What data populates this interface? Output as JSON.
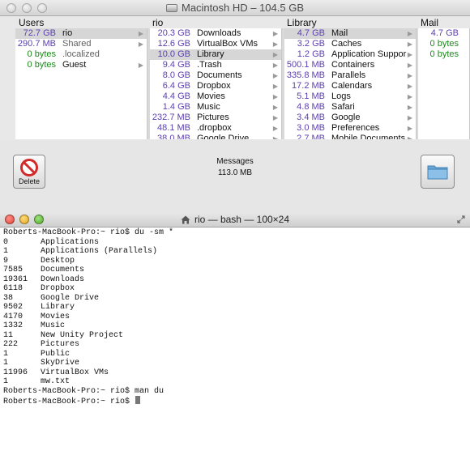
{
  "finder": {
    "title": "Macintosh HD – 104.5 GB",
    "columns": [
      {
        "header": "Users",
        "items": [
          {
            "size": "72.7 GB",
            "name": "rio",
            "selected": true,
            "arrow": true,
            "size_color": "purple"
          },
          {
            "size": "290.7 MB",
            "name": "Shared",
            "selected": false,
            "arrow": true,
            "size_color": "purple",
            "dim": true
          },
          {
            "size": "0 bytes",
            "name": ".localized",
            "selected": false,
            "arrow": false,
            "size_color": "green",
            "dim": true
          },
          {
            "size": "0 bytes",
            "name": "Guest",
            "selected": false,
            "arrow": true,
            "size_color": "green"
          }
        ]
      },
      {
        "header": "rio",
        "items": [
          {
            "size": "20.3 GB",
            "name": "Downloads",
            "selected": false,
            "arrow": true,
            "size_color": "purple"
          },
          {
            "size": "12.6 GB",
            "name": "VirtualBox VMs",
            "selected": false,
            "arrow": true,
            "size_color": "purple"
          },
          {
            "size": "10.0 GB",
            "name": "Library",
            "selected": true,
            "arrow": true,
            "size_color": "purple"
          },
          {
            "size": "9.4 GB",
            "name": ".Trash",
            "selected": false,
            "arrow": true,
            "size_color": "purple"
          },
          {
            "size": "8.0 GB",
            "name": "Documents",
            "selected": false,
            "arrow": true,
            "size_color": "purple"
          },
          {
            "size": "6.4 GB",
            "name": "Dropbox",
            "selected": false,
            "arrow": true,
            "size_color": "purple"
          },
          {
            "size": "4.4 GB",
            "name": "Movies",
            "selected": false,
            "arrow": true,
            "size_color": "purple"
          },
          {
            "size": "1.4 GB",
            "name": "Music",
            "selected": false,
            "arrow": true,
            "size_color": "purple"
          },
          {
            "size": "232.7 MB",
            "name": "Pictures",
            "selected": false,
            "arrow": true,
            "size_color": "purple"
          },
          {
            "size": "48.1 MB",
            "name": ".dropbox",
            "selected": false,
            "arrow": true,
            "size_color": "purple"
          },
          {
            "size": "38.0 MB",
            "name": "Google Drive",
            "selected": false,
            "arrow": true,
            "size_color": "purple"
          }
        ]
      },
      {
        "header": "Library",
        "items": [
          {
            "size": "4.7 GB",
            "name": "Mail",
            "selected": true,
            "arrow": true,
            "size_color": "purple"
          },
          {
            "size": "3.2 GB",
            "name": "Caches",
            "selected": false,
            "arrow": true,
            "size_color": "purple"
          },
          {
            "size": "1.2 GB",
            "name": "Application Suppor",
            "selected": false,
            "arrow": true,
            "size_color": "purple"
          },
          {
            "size": "500.1 MB",
            "name": "Containers",
            "selected": false,
            "arrow": true,
            "size_color": "purple"
          },
          {
            "size": "335.8 MB",
            "name": "Parallels",
            "selected": false,
            "arrow": true,
            "size_color": "purple"
          },
          {
            "size": "17.2 MB",
            "name": "Calendars",
            "selected": false,
            "arrow": true,
            "size_color": "purple"
          },
          {
            "size": "5.1 MB",
            "name": "Logs",
            "selected": false,
            "arrow": true,
            "size_color": "purple"
          },
          {
            "size": "4.8 MB",
            "name": "Safari",
            "selected": false,
            "arrow": true,
            "size_color": "purple"
          },
          {
            "size": "3.4 MB",
            "name": "Google",
            "selected": false,
            "arrow": true,
            "size_color": "purple"
          },
          {
            "size": "3.0 MB",
            "name": "Preferences",
            "selected": false,
            "arrow": true,
            "size_color": "purple"
          },
          {
            "size": "2.7 MB",
            "name": "Mobile Documents",
            "selected": false,
            "arrow": true,
            "size_color": "purple"
          }
        ]
      },
      {
        "header": "Mail",
        "items": [
          {
            "size": "4.7 GB",
            "name": "",
            "selected": false,
            "arrow": false,
            "size_color": "purple"
          },
          {
            "size": "0 bytes",
            "name": "",
            "selected": false,
            "arrow": false,
            "size_color": "green"
          },
          {
            "size": "0 bytes",
            "name": "",
            "selected": false,
            "arrow": false,
            "size_color": "green"
          }
        ]
      }
    ],
    "info_name": "Messages",
    "info_size": "113.0 MB",
    "delete_label": "Delete"
  },
  "terminal": {
    "title": "rio — bash — 100×24",
    "lines": [
      {
        "text": "Roberts-MacBook-Pro:~ rio$ du -sm *"
      },
      {
        "size": "0",
        "name": "Applications"
      },
      {
        "size": "1",
        "name": "Applications (Parallels)"
      },
      {
        "size": "9",
        "name": "Desktop"
      },
      {
        "size": "7585",
        "name": "Documents"
      },
      {
        "size": "19361",
        "name": "Downloads"
      },
      {
        "size": "6118",
        "name": "Dropbox"
      },
      {
        "size": "38",
        "name": "Google Drive"
      },
      {
        "size": "9502",
        "name": "Library"
      },
      {
        "size": "4170",
        "name": "Movies"
      },
      {
        "size": "1332",
        "name": "Music"
      },
      {
        "size": "11",
        "name": "New Unity Project"
      },
      {
        "size": "222",
        "name": "Pictures"
      },
      {
        "size": "1",
        "name": "Public"
      },
      {
        "size": "1",
        "name": "SkyDrive"
      },
      {
        "size": "11996",
        "name": "VirtualBox VMs"
      },
      {
        "size": "1",
        "name": "mw.txt"
      },
      {
        "text": "Roberts-MacBook-Pro:~ rio$ man du"
      }
    ],
    "prompt": "Roberts-MacBook-Pro:~ rio$ "
  },
  "colors": {
    "purple": "#5b3fb0",
    "green": "#1d8a1d"
  }
}
